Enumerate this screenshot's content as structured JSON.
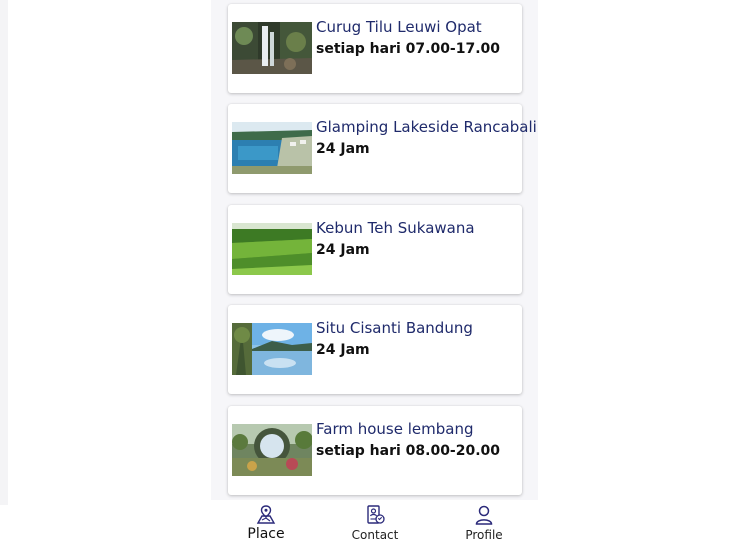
{
  "places": [
    {
      "name": "Curug Tilu Leuwi Opat",
      "hours": "setiap hari 07.00-17.00",
      "thumb_icon": "waterfall-photo"
    },
    {
      "name": "Glamping Lakeside Rancabali",
      "hours": "24 Jam",
      "thumb_icon": "lake-photo"
    },
    {
      "name": "Kebun Teh Sukawana",
      "hours": "24 Jam",
      "thumb_icon": "tea-garden-photo"
    },
    {
      "name": "Situ Cisanti Bandung",
      "hours": "24 Jam",
      "thumb_icon": "mountain-lake-photo"
    },
    {
      "name": "Farm house lembang",
      "hours": "setiap hari 08.00-20.00",
      "thumb_icon": "farmhouse-arch-photo"
    }
  ],
  "nav": {
    "place": "Place",
    "contact": "Contact",
    "profile": "Profile"
  },
  "colors": {
    "title": "#1f2a6b",
    "icon": "#2b2a7a",
    "background": "#f6f6f9"
  }
}
